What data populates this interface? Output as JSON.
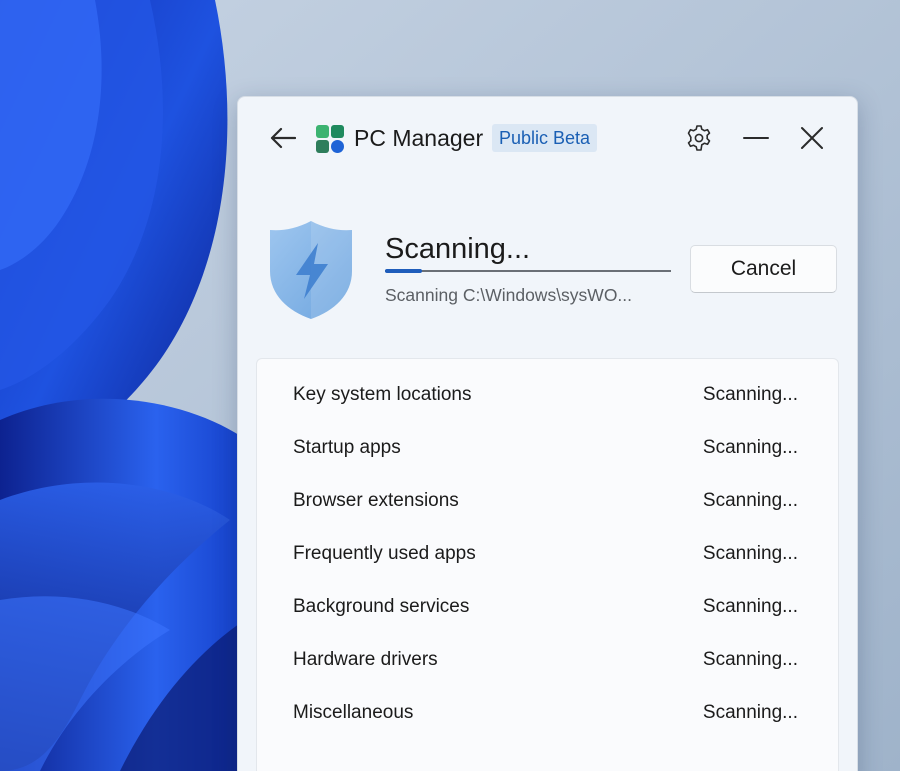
{
  "app": {
    "title": "PC Manager",
    "badge": "Public Beta"
  },
  "icons": {
    "back": "back-arrow-icon",
    "logo": "pc-manager-logo-icon",
    "settings": "gear-icon",
    "minimize": "minimize-icon",
    "close": "close-icon",
    "shield": "shield-lightning-icon"
  },
  "scan": {
    "title": "Scanning...",
    "progress_percent": 13,
    "current_path": "Scanning C:\\Windows\\sysWO...",
    "cancel_label": "Cancel"
  },
  "items": [
    {
      "label": "Key system locations",
      "status": "Scanning..."
    },
    {
      "label": "Startup apps",
      "status": "Scanning..."
    },
    {
      "label": "Browser extensions",
      "status": "Scanning..."
    },
    {
      "label": "Frequently used apps",
      "status": "Scanning..."
    },
    {
      "label": "Background services",
      "status": "Scanning..."
    },
    {
      "label": "Hardware drivers",
      "status": "Scanning..."
    },
    {
      "label": "Miscellaneous",
      "status": "Scanning..."
    }
  ],
  "colors": {
    "accent": "#1f5dbb",
    "badge_bg": "#dbe7f4",
    "badge_text": "#1a5fb4",
    "window_bg": "#f1f5fa"
  }
}
